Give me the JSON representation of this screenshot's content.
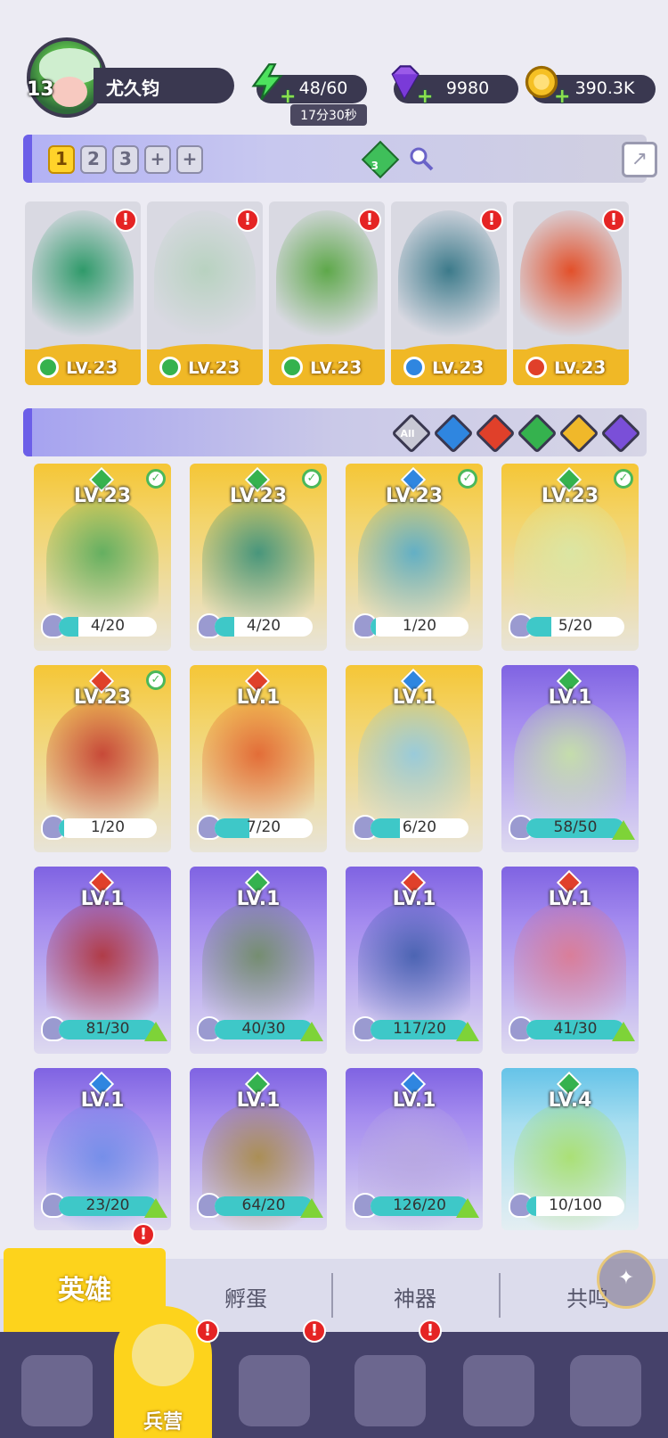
{
  "player": {
    "level": "13",
    "name": "尤久钧"
  },
  "resources": {
    "energy": "48/60",
    "energy_timer": "17分30秒",
    "gems": "9980",
    "gold": "390.3K"
  },
  "team_tabs": [
    "1",
    "2",
    "3",
    "+",
    "+"
  ],
  "team_gem_count": "3",
  "team": [
    {
      "level": "LV.23",
      "element": "nature"
    },
    {
      "level": "LV.23",
      "element": "nature"
    },
    {
      "level": "LV.23",
      "element": "nature"
    },
    {
      "level": "LV.23",
      "element": "water"
    },
    {
      "level": "LV.23",
      "element": "fire"
    }
  ],
  "filters": [
    "All",
    "water",
    "fire",
    "nature",
    "light",
    "dark"
  ],
  "heroes": [
    {
      "level": "LV.23",
      "shards": "4/20",
      "fill": 0.2,
      "rarity": "gold",
      "element": "nature",
      "owned": true
    },
    {
      "level": "LV.23",
      "shards": "4/20",
      "fill": 0.2,
      "rarity": "gold",
      "element": "nature",
      "owned": true
    },
    {
      "level": "LV.23",
      "shards": "1/20",
      "fill": 0.05,
      "rarity": "gold",
      "element": "water",
      "owned": true
    },
    {
      "level": "LV.23",
      "shards": "5/20",
      "fill": 0.25,
      "rarity": "gold",
      "element": "nature",
      "owned": true
    },
    {
      "level": "LV.23",
      "shards": "1/20",
      "fill": 0.05,
      "rarity": "gold",
      "element": "fire",
      "owned": true
    },
    {
      "level": "LV.1",
      "shards": "7/20",
      "fill": 0.35,
      "rarity": "gold",
      "element": "fire",
      "owned": false
    },
    {
      "level": "LV.1",
      "shards": "6/20",
      "fill": 0.3,
      "rarity": "gold",
      "element": "water",
      "owned": false
    },
    {
      "level": "LV.1",
      "shards": "58/50",
      "fill": 1,
      "rarity": "purple",
      "element": "nature",
      "owned": false
    },
    {
      "level": "LV.1",
      "shards": "81/30",
      "fill": 1,
      "rarity": "purple",
      "element": "fire",
      "owned": false
    },
    {
      "level": "LV.1",
      "shards": "40/30",
      "fill": 1,
      "rarity": "purple",
      "element": "nature",
      "owned": false
    },
    {
      "level": "LV.1",
      "shards": "117/20",
      "fill": 1,
      "rarity": "purple",
      "element": "fire",
      "owned": false
    },
    {
      "level": "LV.1",
      "shards": "41/30",
      "fill": 1,
      "rarity": "purple",
      "element": "fire",
      "owned": false
    },
    {
      "level": "LV.1",
      "shards": "23/20",
      "fill": 1,
      "rarity": "purple",
      "element": "water",
      "owned": false
    },
    {
      "level": "LV.1",
      "shards": "64/20",
      "fill": 1,
      "rarity": "purple",
      "element": "nature",
      "owned": false
    },
    {
      "level": "LV.1",
      "shards": "126/20",
      "fill": 1,
      "rarity": "purple",
      "element": "water",
      "owned": false
    },
    {
      "level": "LV.4",
      "shards": "10/100",
      "fill": 0.1,
      "rarity": "cyan",
      "element": "nature",
      "owned": false
    }
  ],
  "sub_tabs": {
    "hero": "英雄",
    "hatch": "孵蛋",
    "artifact": "神器",
    "resonance": "共鸣"
  },
  "nav": {
    "barracks": "兵营"
  },
  "element_colors": {
    "nature": "#35b24e",
    "water": "#2f86e0",
    "fire": "#e0402a",
    "light": "#f0b82a",
    "dark": "#7a4fd8",
    "all": "#ffffff"
  },
  "alert_glyph": "!",
  "check_glyph": "✓",
  "icons": {
    "energy": "lightning-icon",
    "gems": "gem-icon",
    "gold": "coin-icon",
    "search": "magnifier-icon",
    "share": "share-icon"
  }
}
